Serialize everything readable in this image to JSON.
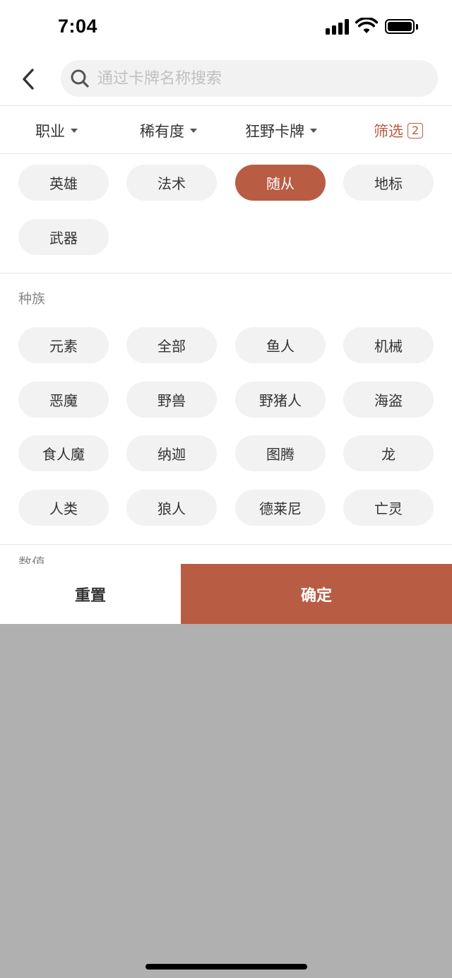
{
  "status_bar": {
    "time": "7:04",
    "signal_icon": "cellular-signal-icon",
    "wifi_icon": "wifi-icon",
    "battery_icon": "battery-icon"
  },
  "header": {
    "back_icon": "chevron-left-icon",
    "search": {
      "placeholder": "通过卡牌名称搜索",
      "value": "",
      "icon": "search-icon"
    }
  },
  "filters": {
    "class_label": "职业",
    "rarity_label": "稀有度",
    "wild_label": "狂野卡牌",
    "advanced_label": "筛选",
    "advanced_count": "2",
    "caret_icon": "caret-down-icon"
  },
  "card_types": {
    "items": [
      {
        "label": "英雄",
        "active": false
      },
      {
        "label": "法术",
        "active": false
      },
      {
        "label": "随从",
        "active": true
      },
      {
        "label": "地标",
        "active": false
      },
      {
        "label": "武器",
        "active": false
      }
    ]
  },
  "race": {
    "title": "种族",
    "items": [
      {
        "label": "元素"
      },
      {
        "label": "全部"
      },
      {
        "label": "鱼人"
      },
      {
        "label": "机械"
      },
      {
        "label": "恶魔"
      },
      {
        "label": "野兽"
      },
      {
        "label": "野猪人"
      },
      {
        "label": "海盗"
      },
      {
        "label": "食人魔"
      },
      {
        "label": "纳迦"
      },
      {
        "label": "图腾"
      },
      {
        "label": "龙"
      },
      {
        "label": "人类"
      },
      {
        "label": "狼人"
      },
      {
        "label": "德莱尼"
      },
      {
        "label": "亡灵"
      }
    ]
  },
  "next_section": {
    "title": "数值"
  },
  "actions": {
    "reset_label": "重置",
    "confirm_label": "确定"
  },
  "colors": {
    "accent": "#b85c44",
    "chip_bg": "#f2f2f2",
    "overlay": "#b0b0b0"
  }
}
